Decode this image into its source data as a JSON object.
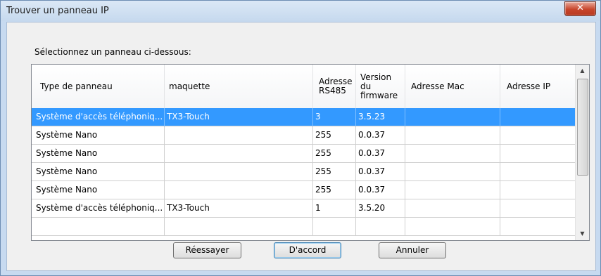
{
  "window": {
    "title": "Trouver un panneau IP",
    "close_glyph": "✕"
  },
  "prompt": "Sélectionnez un panneau ci-dessous:",
  "table": {
    "columns": [
      "Type de panneau",
      "maquette",
      "Adresse RS485",
      "Version du firmware",
      "Adresse Mac",
      "Adresse IP"
    ],
    "rows": [
      [
        "Système d'accès téléphoniq...",
        "TX3-Touch",
        "3",
        "3.5.23",
        "",
        ""
      ],
      [
        "Système Nano",
        "",
        "255",
        "0.0.37",
        "",
        ""
      ],
      [
        "Système Nano",
        "",
        "255",
        "0.0.37",
        "",
        ""
      ],
      [
        "Système Nano",
        "",
        "255",
        "0.0.37",
        "",
        ""
      ],
      [
        "Système Nano",
        "",
        "255",
        "0.0.37",
        "",
        ""
      ],
      [
        "Système d'accès téléphoniq...",
        "TX3-Touch",
        "1",
        "3.5.20",
        "",
        ""
      ]
    ],
    "selected_row": 0
  },
  "buttons": {
    "retry": "Réessayer",
    "ok": "D'accord",
    "cancel": "Annuler"
  },
  "colors": {
    "selection": "#3399ff",
    "window_frame": "#c7daf0",
    "close_button": "#c7452b"
  },
  "icons": {
    "scroll_up": "scroll-up-arrow-icon",
    "scroll_down": "scroll-down-arrow-icon",
    "close": "close-icon"
  }
}
